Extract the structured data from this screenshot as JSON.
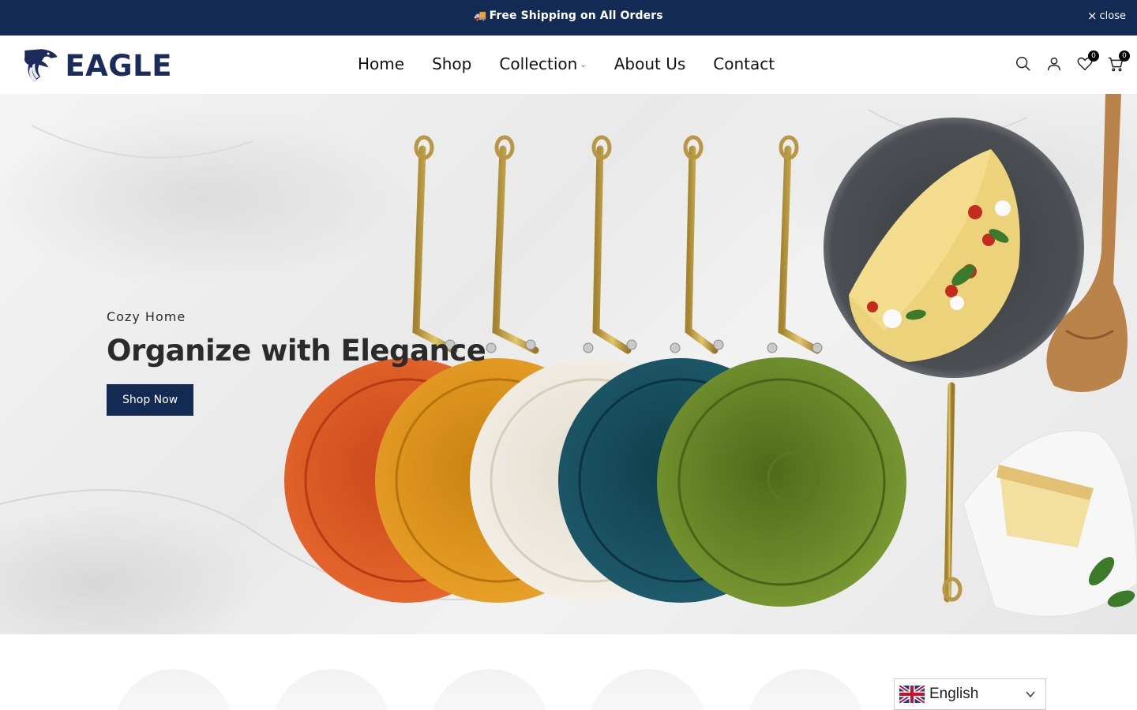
{
  "announcement": {
    "icon": "delivery-truck-icon",
    "text": "Free Shipping on All Orders",
    "close_label": "close"
  },
  "brand": {
    "name": "EAGLE",
    "color": "#1b2c5c"
  },
  "nav": {
    "items": [
      {
        "label": "Home"
      },
      {
        "label": "Shop"
      },
      {
        "label": "Collection",
        "has_dropdown": true
      },
      {
        "label": "About Us"
      },
      {
        "label": "Contact"
      }
    ]
  },
  "header_icons": {
    "search": "search-icon",
    "account": "account-icon",
    "wishlist": "heart-icon",
    "wishlist_count": "0",
    "cart": "cart-icon",
    "cart_count": "0"
  },
  "hero": {
    "subtitle": "Cozy Home",
    "title": "Organize with Elegance",
    "button_label": "Shop Now",
    "accent_color": "#132a55"
  },
  "language": {
    "selected": "English",
    "flag": "uk-flag-icon"
  }
}
